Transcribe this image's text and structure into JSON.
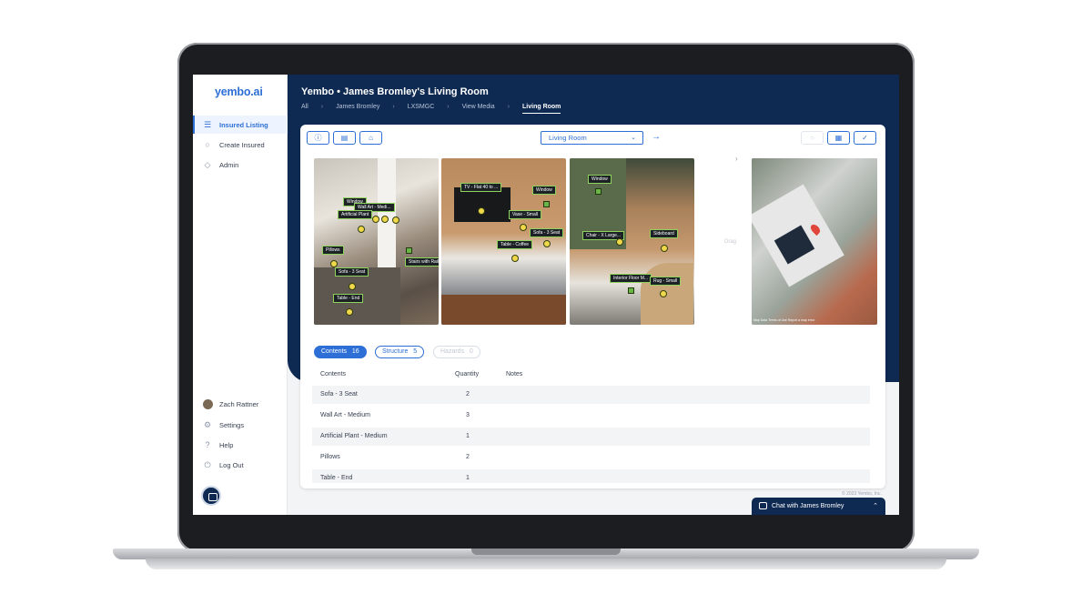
{
  "app": {
    "logo": "yembo.ai"
  },
  "sidebar": {
    "items": [
      {
        "label": "Insured Listing"
      },
      {
        "label": "Create Insured"
      },
      {
        "label": "Admin"
      }
    ],
    "bottom": [
      {
        "label": "Zach Rattner"
      },
      {
        "label": "Settings"
      },
      {
        "label": "Help"
      },
      {
        "label": "Log Out"
      }
    ]
  },
  "header": {
    "title": "Yembo • James Bromley's Living Room",
    "breadcrumbs": [
      "All",
      "James Bromley",
      "LXSMGC",
      "View Media",
      "Living Room"
    ]
  },
  "toolbar": {
    "room_select": "Living Room"
  },
  "photos": {
    "p1_tags": [
      "Window",
      "Wall Art - Medi...",
      "Artificial Plant",
      "Pillows",
      "Sofa - 3 Seat",
      "Table - End",
      "Stairs with Raili..."
    ],
    "p2_tags": [
      "TV - Flat 40 to ...",
      "Window",
      "Vase - Small",
      "Sofa - 3 Seat",
      "Table - Coffee"
    ],
    "p3_tags": [
      "Window",
      "Chair - X Large...",
      "Sideboard",
      "Interior Floor M...",
      "Rug - Small"
    ],
    "faint_label": "Drag",
    "map_attribution": "Map Data   Terms of Use   Report a map error"
  },
  "tabs": [
    {
      "label": "Contents",
      "count": "16"
    },
    {
      "label": "Structure",
      "count": "5"
    },
    {
      "label": "Hazards",
      "count": "0"
    }
  ],
  "table": {
    "headers": [
      "Contents",
      "Quantity",
      "Notes"
    ],
    "rows": [
      {
        "name": "Sofa - 3 Seat",
        "qty": "2"
      },
      {
        "name": "Wall Art - Medium",
        "qty": "3"
      },
      {
        "name": "Artificial Plant - Medium",
        "qty": "1"
      },
      {
        "name": "Pillows",
        "qty": "2"
      },
      {
        "name": "Table - End",
        "qty": "1"
      }
    ]
  },
  "footer": {
    "copyright": "© 2023 Yembo, Inc.",
    "chat_label": "Chat with James Bromley"
  }
}
